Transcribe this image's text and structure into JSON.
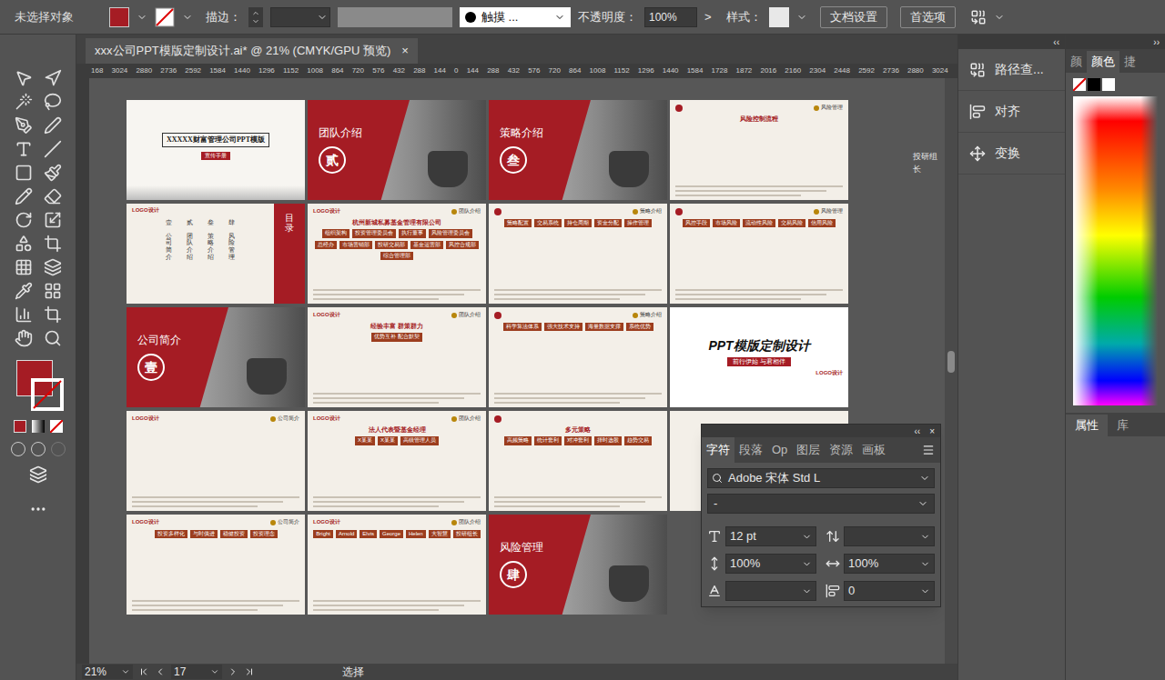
{
  "toolbar": {
    "selection": "未选择对象",
    "stroke_label": "描边：",
    "brush": "触摸 ...",
    "opacity_label": "不透明度：",
    "opacity": "100%",
    "opacity_arrow": ">",
    "style_label": "样式：",
    "buttons": [
      "文档设置",
      "首选项"
    ]
  },
  "document_tab": {
    "title": "xxx公司PPT模版定制设计.ai* @ 21% (CMYK/GPU 预览)",
    "close": "×",
    "selected": true
  },
  "ruler": [
    "168",
    "3024",
    "2880",
    "2736",
    "2592",
    "1584",
    "1440",
    "1296",
    "1152",
    "1008",
    "864",
    "720",
    "576",
    "432",
    "288",
    "144",
    "0",
    "144",
    "288",
    "432",
    "576",
    "720",
    "864",
    "1008",
    "1152",
    "1296",
    "1440",
    "1584",
    "1728",
    "1872",
    "2016",
    "2160",
    "2304",
    "2448",
    "2592",
    "2736",
    "2880",
    "3024"
  ],
  "slides": [
    {
      "kind": "cover",
      "title": "XXXXX财富管理公司PPT模版",
      "tag": "宣传手册"
    },
    {
      "kind": "section",
      "title": "团队介绍",
      "numeral": "贰"
    },
    {
      "kind": "section",
      "title": "策略介绍",
      "numeral": "叁"
    },
    {
      "kind": "content",
      "header": "风险管理",
      "subtitle": "风险控制流程",
      "items": []
    },
    {
      "kind": "toc",
      "logo": "LOGO设计",
      "numerals": [
        "壹",
        "贰",
        "叁",
        "肆"
      ],
      "entries": [
        "公司简介",
        "团队介绍",
        "策略介绍",
        "风险管理"
      ],
      "band": "目录"
    },
    {
      "kind": "content",
      "logo": "LOGO设计",
      "header": "团队介绍",
      "subtitle": "杭州新城私募基金管理有限公司",
      "items": [
        "组织架构",
        "投资管理委员会",
        "执行董事",
        "风险管理委员会",
        "总经办",
        "市场营销部",
        "投研交易部",
        "基金运营部",
        "风控合规部",
        "综合管理部"
      ]
    },
    {
      "kind": "content",
      "header": "策略介绍",
      "items": [
        "策略配置",
        "交易系统",
        "持仓周期",
        "资金分配",
        "操作管理"
      ]
    },
    {
      "kind": "content",
      "header": "风险管理",
      "items": [
        "风控手段",
        "市场风险",
        "流动性风险",
        "交易风险",
        "信用风险"
      ]
    },
    {
      "kind": "section",
      "title": "公司简介",
      "numeral": "壹"
    },
    {
      "kind": "content",
      "logo": "LOGO设计",
      "header": "团队介绍",
      "subtitle": "经验丰富 群策群力",
      "items": [
        "优势互补 配合默契"
      ]
    },
    {
      "kind": "content",
      "header": "策略介绍",
      "items": [
        "科学算法体系",
        "强大技术支持",
        "海量数据支撑",
        "系统优势"
      ]
    },
    {
      "kind": "end",
      "title": "PPT模版定制设计",
      "tagline": "前行伊始 与君相伴",
      "logo": "LOGO设计"
    },
    {
      "kind": "content",
      "logo": "LOGO设计",
      "header": "公司简介",
      "items": []
    },
    {
      "kind": "content",
      "logo": "LOGO设计",
      "header": "团队介绍",
      "subtitle": "法人代表暨基金经理",
      "items": [
        "X某某",
        "X某某",
        "高级管理人员"
      ]
    },
    {
      "kind": "content",
      "subtitle": "多元策略",
      "items": [
        "高频策略",
        "统计套利",
        "对冲套利",
        "择时选股",
        "趋势交易"
      ]
    },
    {
      "kind": "hidden"
    },
    {
      "kind": "content",
      "logo": "LOGO设计",
      "header": "公司简介",
      "items": [
        "投资多样化",
        "与时俱进",
        "稳健投资",
        "投资理念"
      ]
    },
    {
      "kind": "content",
      "logo": "LOGO设计",
      "header": "团队介绍",
      "items": [
        "Bright",
        "Arnold",
        "Elvis",
        "George",
        "Helen",
        "大智慧",
        "投研组长"
      ]
    },
    {
      "kind": "section",
      "title": "风险管理",
      "numeral": "肆"
    }
  ],
  "canvas_text": "投研组长",
  "status_bar": {
    "zoom": "21%",
    "artboard": "17",
    "tool": "选择"
  },
  "side_panels": {
    "header": "‹‹",
    "items": [
      "路径查...",
      "对齐",
      "变换"
    ]
  },
  "color_panel": {
    "header": "››",
    "tabs": [
      {
        "label": "颜",
        "selected": false
      },
      {
        "label": "颜色",
        "selected": true
      },
      {
        "label": "捷",
        "selected": false
      }
    ]
  },
  "bottom_tabs": [
    {
      "label": "属性",
      "selected": true
    },
    {
      "label": "库",
      "selected": false
    }
  ],
  "character_panel": {
    "collapse": "‹‹",
    "close": "×",
    "tabs": [
      {
        "label": "字符",
        "selected": true
      },
      {
        "label": "段落",
        "selected": false
      },
      {
        "label": "Op",
        "selected": false
      },
      {
        "label": "图层",
        "selected": false
      },
      {
        "label": "资源",
        "selected": false
      },
      {
        "label": "画板",
        "selected": false
      }
    ],
    "font": "Adobe 宋体 Std L",
    "style": "-",
    "size": "12 pt",
    "vscale": "100%",
    "hscale": "100%",
    "tracking": "0"
  }
}
